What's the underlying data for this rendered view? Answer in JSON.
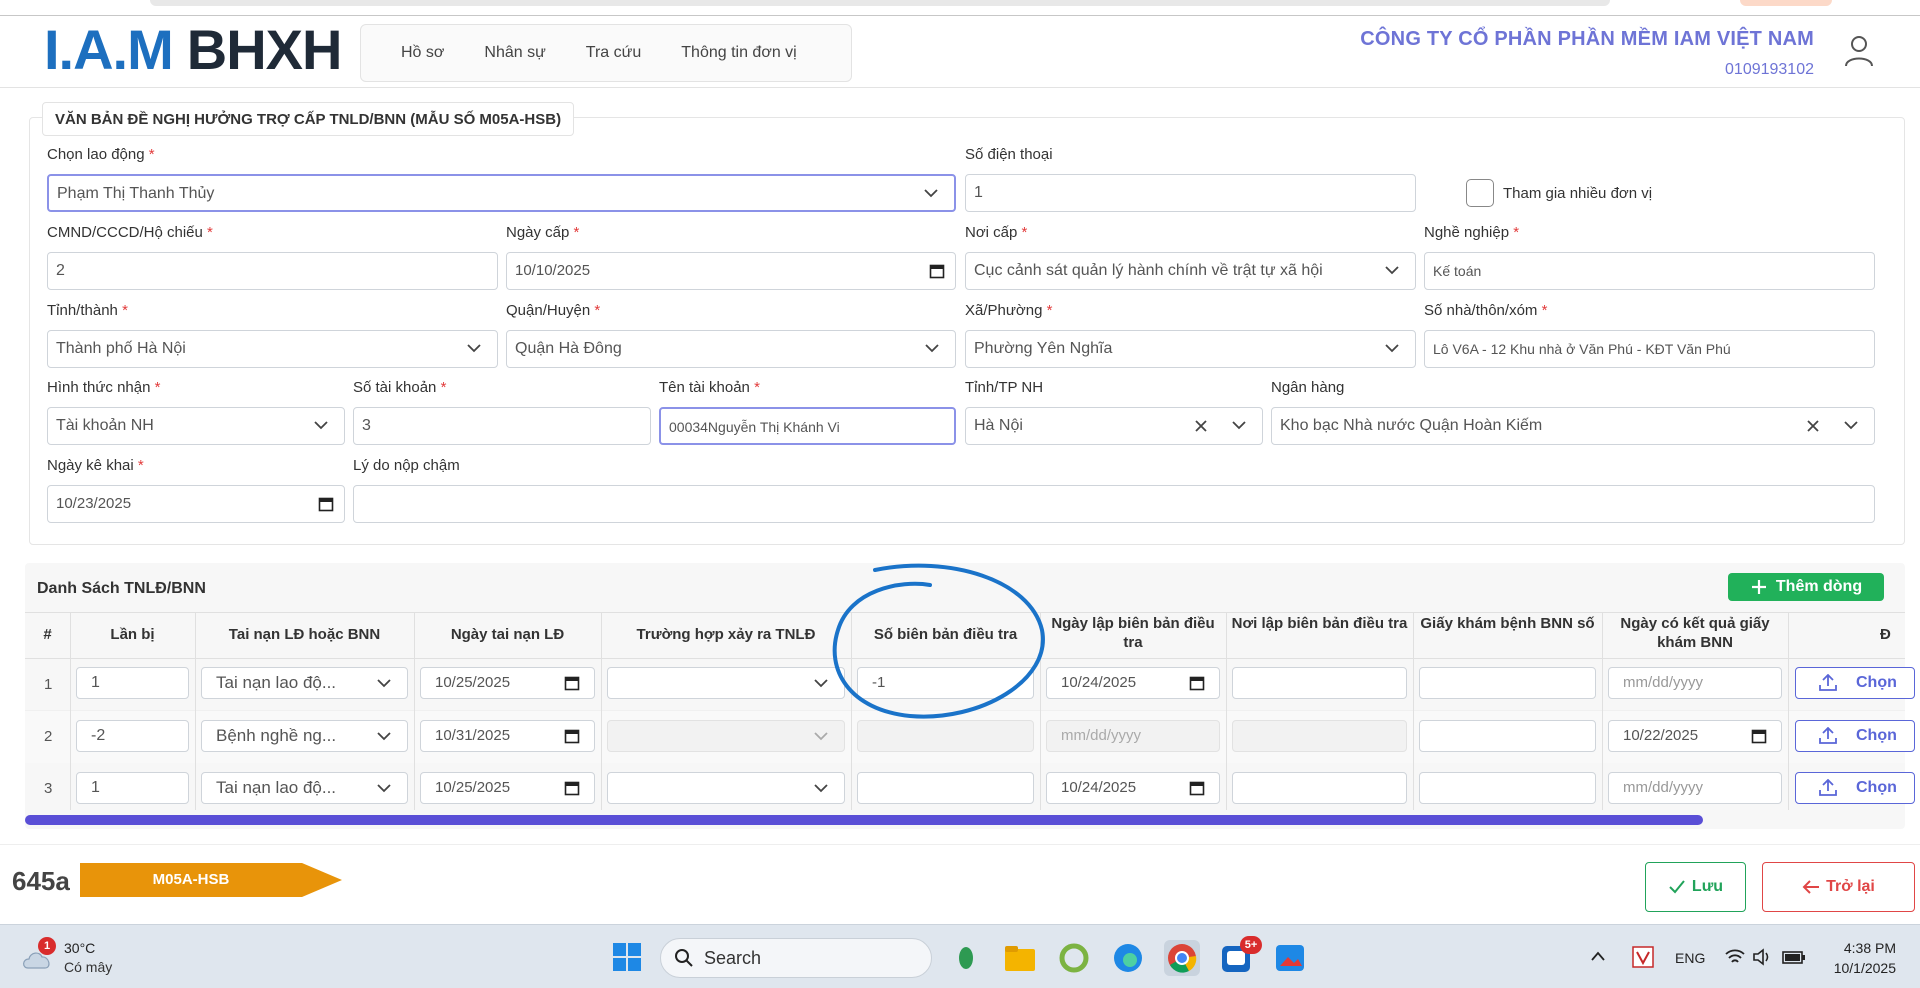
{
  "header": {
    "logo_iam": "I.A.M",
    "logo_bhxh": "BHXH",
    "nav": [
      "Hồ sơ",
      "Nhân sự",
      "Tra cứu",
      "Thông tin đơn vị"
    ],
    "company_name": "CÔNG TY CỔ PHẦN PHẦN MỀM IAM VIỆT NAM",
    "company_code": "0109193102"
  },
  "form": {
    "title": "VĂN BẢN ĐỀ NGHỊ HƯỞNG TRỢ CẤP TNLD/BNN (MẪU SỐ M05A-HSB)",
    "required_mark": "*",
    "chon_lao_dong": {
      "label": "Chọn lao động",
      "value": "Phạm Thị Thanh Thủy"
    },
    "so_dien_thoai": {
      "label": "Số điện thoại",
      "value": "1"
    },
    "tham_gia": {
      "label": "Tham gia nhiều đơn vị"
    },
    "cmnd": {
      "label": "CMND/CCCD/Hộ chiếu",
      "value": "2"
    },
    "ngay_cap": {
      "label": "Ngày cấp",
      "value": "10/10/2025"
    },
    "noi_cap": {
      "label": "Nơi cấp",
      "value": "Cục cảnh sát quản lý hành chính về trật tự xã hội"
    },
    "nghe_nghiep": {
      "label": "Nghề nghiệp",
      "value": "Kế toán"
    },
    "tinh_thanh": {
      "label": "Tỉnh/thành",
      "value": "Thành phố Hà Nội"
    },
    "quan_huyen": {
      "label": "Quận/Huyện",
      "value": "Quận Hà Đông"
    },
    "xa_phuong": {
      "label": "Xã/Phường",
      "value": "Phường Yên Nghĩa"
    },
    "so_nha": {
      "label": "Số nhà/thôn/xóm",
      "value": "Lô V6A - 12 Khu nhà ở Văn Phú - KĐT Văn Phú"
    },
    "hinh_thuc_nhan": {
      "label": "Hình thức nhận",
      "value": "Tài khoản NH"
    },
    "so_tai_khoan": {
      "label": "Số tài khoản",
      "value": "3"
    },
    "ten_tai_khoan": {
      "label": "Tên tài khoản",
      "value": "00034Nguyễn Thị Khánh Vi"
    },
    "tinh_tp_nh": {
      "label": "Tỉnh/TP NH",
      "value": "Hà Nội"
    },
    "ngan_hang": {
      "label": "Ngân hàng",
      "value": "Kho bạc Nhà nước Quận Hoàn Kiếm"
    },
    "ngay_ke_khai": {
      "label": "Ngày kê khai",
      "value": "10/23/2025"
    },
    "ly_do": {
      "label": "Lý do nộp chậm",
      "value": ""
    }
  },
  "table": {
    "title": "Danh Sách TNLĐ/BNN",
    "add_button": "Thêm dòng",
    "columns": [
      "#",
      "Lần bị",
      "Tai nạn LĐ hoặc BNN",
      "Ngày tai nạn LĐ",
      "Trường hợp xảy ra TNLĐ",
      "Số biên bản điều tra",
      "Ngày lập biên bản điều tra",
      "Nơi lập biên bản điều tra",
      "Giấy khám bệnh BNN số",
      "Ngày có kết quả giấy khám BNN",
      "Đ"
    ],
    "date_placeholder": "mm/dd/yyyy",
    "choose_label": "Chọn",
    "rows": [
      {
        "idx": "1",
        "lan_bi": "1",
        "loai": "Tai nạn lao độ...",
        "ngay_tn": "10/25/2025",
        "truong_hop": "",
        "so_bb": "-1",
        "ngay_lap": "10/24/2025",
        "noi_lap": "",
        "giay_kham": "",
        "ngay_kq": ""
      },
      {
        "idx": "2",
        "lan_bi": "-2",
        "loai": "Bệnh nghề ng...",
        "ngay_tn": "10/31/2025",
        "truong_hop": "",
        "so_bb": "",
        "ngay_lap": "",
        "noi_lap": "",
        "giay_kham": "",
        "ngay_kq": "10/22/2025"
      },
      {
        "idx": "3",
        "lan_bi": "1",
        "loai": "Tai nạn lao độ...",
        "ngay_tn": "10/25/2025",
        "truong_hop": "",
        "so_bb": "",
        "ngay_lap": "10/24/2025",
        "noi_lap": "",
        "giay_kham": "",
        "ngay_kq": ""
      }
    ]
  },
  "footer": {
    "code": "645a",
    "tag": "M05A-HSB",
    "tag_color": "#e8940a",
    "save": "Lưu",
    "back": "Trở lại"
  },
  "taskbar": {
    "weather_badge": "1",
    "temp": "30°C",
    "weather": "Có mây",
    "search": "Search",
    "zalo_badge": "5+",
    "lang": "ENG",
    "time": "4:38 PM",
    "date": "10/1/2025"
  },
  "colors": {
    "accent": "#5a66d8",
    "brand_blue": "#1d6fbf",
    "green": "#21b15a",
    "red": "#e04646"
  }
}
